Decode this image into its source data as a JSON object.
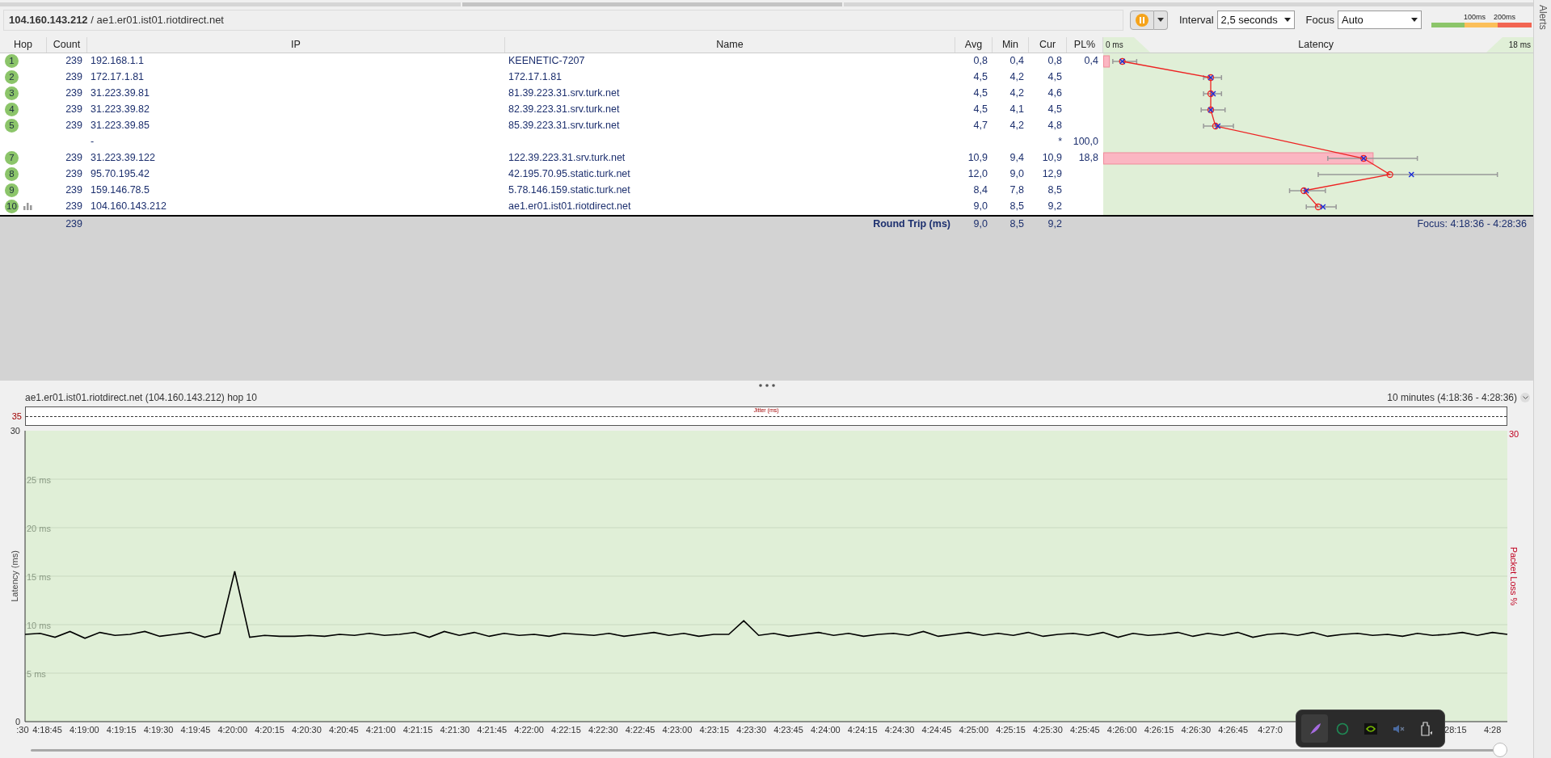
{
  "toolbar": {
    "path": "**104.160.143.212** / ae1.er01.ist01.riotdirect.net",
    "running": true,
    "interval_label": "Interval",
    "interval": "2,5 seconds",
    "focus_label": "Focus",
    "focus": "Auto",
    "scale_labels": [
      "100ms",
      "200ms"
    ]
  },
  "alerts_tab": "Alerts",
  "table": {
    "columns": [
      "Hop",
      "Count",
      "IP",
      "Name",
      "Avg",
      "Min",
      "Cur",
      "PL%"
    ],
    "latency_header": {
      "min": "0 ms",
      "title": "Latency",
      "max": "18 ms"
    },
    "rows": [
      {
        "hop": "1",
        "graphed": false,
        "count": "239",
        "ip": "192.168.1.1",
        "name": "KEENETIC-7207",
        "avg": "0,8",
        "min": "0,4",
        "cur": "0,8",
        "pl": "0,4"
      },
      {
        "hop": "2",
        "graphed": false,
        "count": "239",
        "ip": "172.17.1.81",
        "name": "172.17.1.81",
        "avg": "4,5",
        "min": "4,2",
        "cur": "4,5"
      },
      {
        "hop": "3",
        "graphed": false,
        "count": "239",
        "ip": "31.223.39.81",
        "name": "81.39.223.31.srv.turk.net",
        "avg": "4,5",
        "min": "4,2",
        "cur": "4,6"
      },
      {
        "hop": "4",
        "graphed": false,
        "count": "239",
        "ip": "31.223.39.82",
        "name": "82.39.223.31.srv.turk.net",
        "avg": "4,5",
        "min": "4,1",
        "cur": "4,5"
      },
      {
        "hop": "5",
        "graphed": false,
        "count": "239",
        "ip": "31.223.39.85",
        "name": "85.39.223.31.srv.turk.net",
        "avg": "4,7",
        "min": "4,2",
        "cur": "4,8"
      },
      {
        "graphed": false,
        "ip": "-",
        "cur": "*",
        "pl": "100,0"
      },
      {
        "hop": "7",
        "graphed": false,
        "count": "239",
        "ip": "31.223.39.122",
        "name": "122.39.223.31.srv.turk.net",
        "avg": "10,9",
        "min": "9,4",
        "cur": "10,9",
        "pl": "18,8"
      },
      {
        "hop": "8",
        "graphed": false,
        "count": "239",
        "ip": "95.70.195.42",
        "name": "42.195.70.95.static.turk.net",
        "avg": "12,0",
        "min": "9,0",
        "cur": "12,9"
      },
      {
        "hop": "9",
        "graphed": false,
        "count": "239",
        "ip": "159.146.78.5",
        "name": "5.78.146.159.static.turk.net",
        "avg": "8,4",
        "min": "7,8",
        "cur": "8,5"
      },
      {
        "hop": "10",
        "graphed": true,
        "count": "239",
        "ip": "104.160.143.212",
        "name": "ae1.er01.ist01.riotdirect.net",
        "avg": "9,0",
        "min": "8,5",
        "cur": "9,2"
      }
    ],
    "summary": {
      "count": "239",
      "label": "Round Trip (ms)",
      "avg": "9,0",
      "min": "8,5",
      "cur": "9,2",
      "focus": "Focus: 4:18:36 - 4:28:36"
    }
  },
  "graph": {
    "title": "ae1.er01.ist01.riotdirect.net (104.160.143.212) hop 10",
    "range": "10 minutes (4:18:36 - 4:28:36)",
    "jitter": {
      "label": "Jitter (ms)",
      "max": "35"
    },
    "loss_axis": {
      "max": "30",
      "label": "Packet Loss %"
    },
    "left_axis": {
      "max": "30",
      "min": "0"
    },
    "time_labels": [
      ":30",
      "4:18:45",
      "4:19:00",
      "4:19:15",
      "4:19:30",
      "4:19:45",
      "4:20:00",
      "4:20:15",
      "4:20:30",
      "4:20:45",
      "4:21:00",
      "4:21:15",
      "4:21:30",
      "4:21:45",
      "4:22:00",
      "4:22:15",
      "4:22:30",
      "4:22:45",
      "4:23:00",
      "4:23:15",
      "4:23:30",
      "4:23:45",
      "4:24:00",
      "4:24:15",
      "4:24:30",
      "4:24:45",
      "4:25:00",
      "4:25:15",
      "4:25:30",
      "4:25:45",
      "4:26:00",
      "4:26:15",
      "4:26:30",
      "4:26:45",
      "4:27:0",
      "28:15",
      "4:28"
    ],
    "chart_data": {
      "type": "line",
      "ylabel": "Latency (ms)",
      "ylim": [
        0,
        30
      ],
      "grid": true,
      "yticks": [
        {
          "value": 5,
          "label": "5 ms"
        },
        {
          "value": 10,
          "label": "10 ms"
        },
        {
          "value": 15,
          "label": "15 ms"
        },
        {
          "value": 20,
          "label": "20 ms"
        },
        {
          "value": 25,
          "label": "25 ms"
        }
      ],
      "series": [
        {
          "color": "#000000",
          "values": [
            9.0,
            9.1,
            8.7,
            9.3,
            8.6,
            9.2,
            8.9,
            9.0,
            9.3,
            8.8,
            9.0,
            9.2,
            8.7,
            9.1,
            15.5,
            8.7,
            8.9,
            8.8,
            8.8,
            8.9,
            8.8,
            9.0,
            8.9,
            9.1,
            8.9,
            9.0,
            9.2,
            8.7,
            9.3,
            8.9,
            9.2,
            8.8,
            9.1,
            8.9,
            9.0,
            8.8,
            9.1,
            9.0,
            8.9,
            9.1,
            8.8,
            9.0,
            9.2,
            8.9,
            9.1,
            8.8,
            9.0,
            9.0,
            10.4,
            8.9,
            9.1,
            8.8,
            9.0,
            9.2,
            8.9,
            9.1,
            8.8,
            9.0,
            9.1,
            8.9,
            9.3,
            8.8,
            9.0,
            9.2,
            8.9,
            9.1,
            8.9,
            9.2,
            8.8,
            9.0,
            9.1,
            8.9,
            9.2,
            8.7,
            9.1,
            8.9,
            9.0,
            9.2,
            8.8,
            9.1,
            8.9,
            9.2,
            8.7,
            9.0,
            9.1,
            8.9,
            9.2,
            8.8,
            9.0,
            9.1,
            8.9,
            9.0,
            8.8,
            9.1,
            8.9,
            9.0,
            9.2,
            8.9,
            9.2,
            9.0
          ]
        }
      ]
    }
  },
  "timeline_slider": {
    "level": 1
  },
  "tray_popup": {
    "icons": [
      {
        "kind": "feather",
        "selected": true
      },
      {
        "kind": "ring",
        "selected": false
      },
      {
        "kind": "gpu",
        "selected": false
      },
      {
        "kind": "speaker-mute",
        "selected": false
      },
      {
        "kind": "usb",
        "selected": false
      }
    ]
  }
}
